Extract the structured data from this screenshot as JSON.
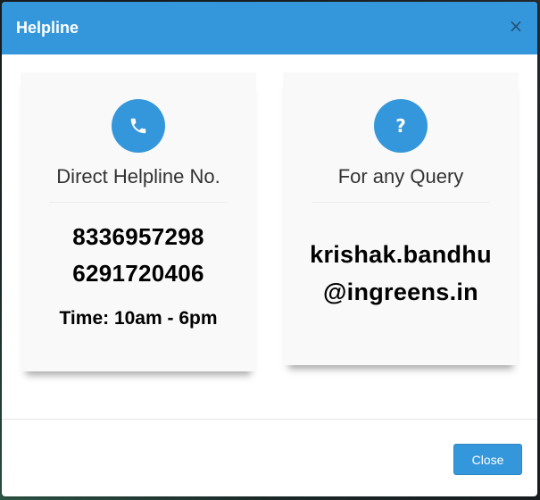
{
  "dialog": {
    "title": "Helpline",
    "close_icon": "×"
  },
  "cards": {
    "helpline": {
      "icon": "phone-icon",
      "heading": "Direct Helpline No.",
      "phone_1": "8336957298",
      "phone_2": "6291720406",
      "time": "Time: 10am - 6pm"
    },
    "query": {
      "icon": "question-icon",
      "icon_glyph": "?",
      "heading": "For any Query",
      "email_line_1": "krishak.bandhu",
      "email_line_2": "@ingreens.in"
    }
  },
  "footer": {
    "close_label": "Close"
  },
  "colors": {
    "accent": "#3597db",
    "header_text": "#ffffff",
    "card_bg": "#f9f9f9"
  }
}
